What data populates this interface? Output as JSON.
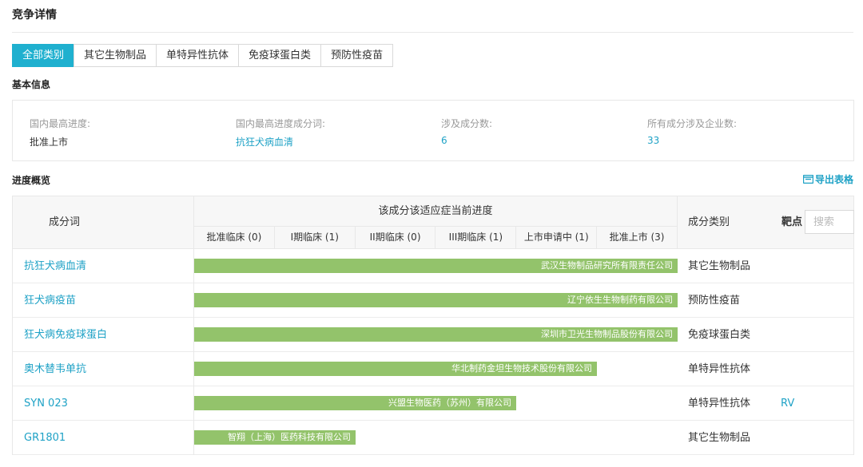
{
  "page_title": "竞争详情",
  "tabs": [
    {
      "label": "全部类别",
      "active": true
    },
    {
      "label": "其它生物制品",
      "active": false
    },
    {
      "label": "单特异性抗体",
      "active": false
    },
    {
      "label": "免疫球蛋白类",
      "active": false
    },
    {
      "label": "预防性疫苗",
      "active": false
    }
  ],
  "basic_info": {
    "title": "基本信息",
    "items": [
      {
        "label": "国内最高进度:",
        "value": "批准上市"
      },
      {
        "label": "国内最高进度成分词:",
        "value": "抗狂犬病血清"
      },
      {
        "label": "涉及成分数:",
        "value": "6"
      },
      {
        "label": "所有成分涉及企业数:",
        "value": "33"
      }
    ]
  },
  "progress": {
    "title": "进度概览",
    "export_label": "导出表格",
    "colors": {
      "accent": "#1fb0cf",
      "link": "#1fa2c6",
      "bar": "#93c36b"
    },
    "table": {
      "col_name": "成分词",
      "col_progress": "该成分该适应症当前进度",
      "phases": [
        "批准临床 (0)",
        "I期临床 (1)",
        "II期临床 (0)",
        "III期临床 (1)",
        "上市申请中 (1)",
        "批准上市 (3)"
      ],
      "col_category": "成分类别",
      "col_target": "靶点",
      "search_placeholder": "搜索"
    },
    "rows": [
      {
        "name": "抗狂犬病血清",
        "company": "武汉生物制品研究所有限责任公司",
        "phase_reached": 6,
        "category": "其它生物制品",
        "target": ""
      },
      {
        "name": "狂犬病疫苗",
        "company": "辽宁依生生物制药有限公司",
        "phase_reached": 6,
        "category": "预防性疫苗",
        "target": ""
      },
      {
        "name": "狂犬病免疫球蛋白",
        "company": "深圳市卫光生物制品股份有限公司",
        "phase_reached": 6,
        "category": "免疫球蛋白类",
        "target": ""
      },
      {
        "name": "奥木替韦单抗",
        "company": "华北制药金坦生物技术股份有限公司",
        "phase_reached": 5,
        "category": "单特异性抗体",
        "target": ""
      },
      {
        "name": "SYN 023",
        "company": "兴盟生物医药（苏州）有限公司",
        "phase_reached": 4,
        "category": "单特异性抗体",
        "target": "RV"
      },
      {
        "name": "GR1801",
        "company": "智翔（上海）医药科技有限公司",
        "phase_reached": 2,
        "category": "其它生物制品",
        "target": ""
      }
    ]
  }
}
